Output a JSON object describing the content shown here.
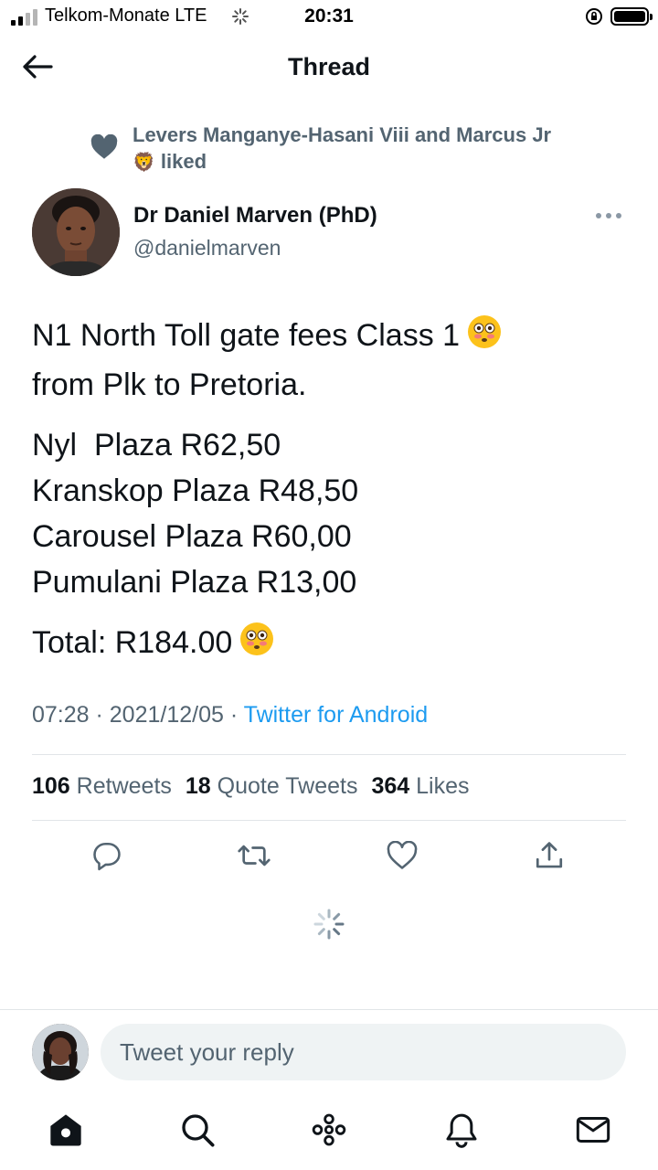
{
  "status_bar": {
    "carrier": "Telkom-Monate  LTE",
    "time": "20:31"
  },
  "header": {
    "title": "Thread",
    "back_icon": "arrow-left-icon"
  },
  "social_context": {
    "text": "Levers Manganye-Hasani Viii and Marcus Jr",
    "emoji": "🦁",
    "suffix": "liked"
  },
  "author": {
    "name": "Dr Daniel Marven (PhD)",
    "handle": "@danielmarven"
  },
  "tweet": {
    "line1": "N1 North Toll gate fees Class 1",
    "line2": "from Plk to Pretoria.",
    "items": [
      "Nyl  Plaza R62,50",
      "Kranskop Plaza R48,50",
      "Carousel Plaza R60,00",
      "Pumulani Plaza R13,00"
    ],
    "total": "Total: R184.00",
    "emoji": "😳"
  },
  "meta": {
    "time": "07:28",
    "sep": " · ",
    "date": "2021/12/05",
    "source": "Twitter for Android"
  },
  "stats": {
    "retweets_count": "106",
    "retweets_label": "Retweets",
    "quotes_count": "18",
    "quotes_label": "Quote Tweets",
    "likes_count": "364",
    "likes_label": "Likes"
  },
  "reply": {
    "placeholder": "Tweet your reply"
  },
  "colors": {
    "primary_text": "#0f1419",
    "secondary_text": "#536471",
    "accent": "#1d9bf0",
    "divider": "#e1e5e8",
    "input_bg": "#eff3f4"
  },
  "tabbar": {
    "icons": [
      "home-icon",
      "search-icon",
      "spaces-icon",
      "notifications-icon",
      "messages-icon"
    ]
  }
}
